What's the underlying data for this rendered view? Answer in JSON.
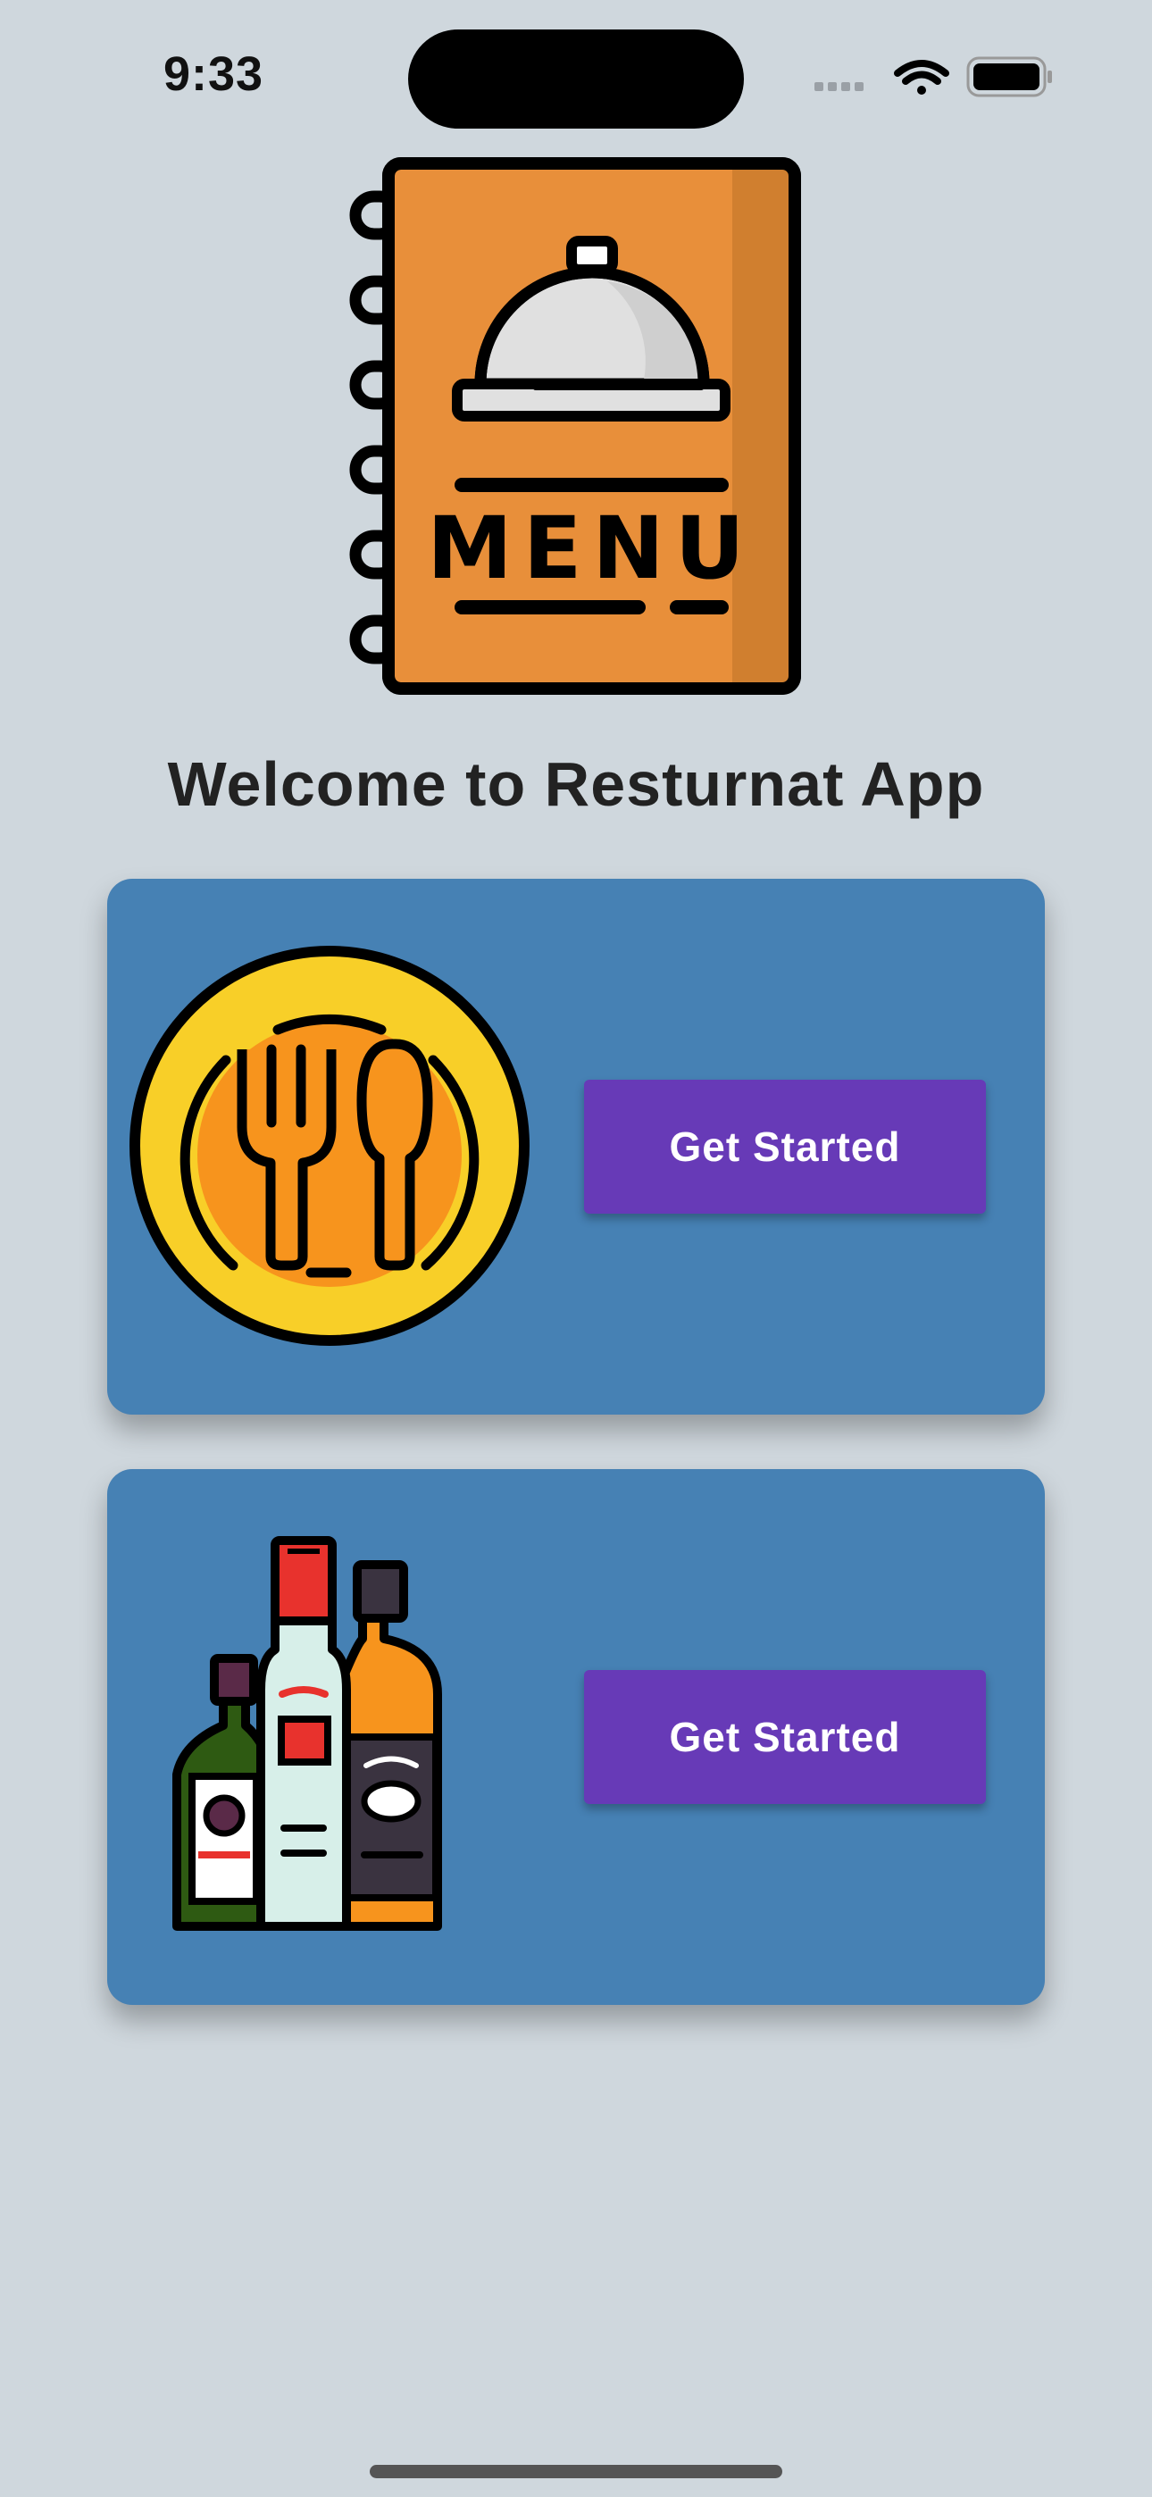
{
  "status_bar": {
    "time": "9:33",
    "icons": [
      "cellular-signal-icon",
      "wifi-icon",
      "battery-icon"
    ]
  },
  "header": {
    "illustration": "menu-book-icon",
    "illustration_text": "MENU",
    "title": "Welcome to Resturnat App"
  },
  "cards": [
    {
      "illustration": "plate-fork-spoon-icon",
      "button_label": "Get Started"
    },
    {
      "illustration": "bottles-icon",
      "button_label": "Get Started"
    }
  ],
  "colors": {
    "background": "#cfd7dd",
    "card": "#4681b4",
    "button": "#673ab7",
    "button_text": "#ffffff",
    "title_text": "#222222"
  }
}
